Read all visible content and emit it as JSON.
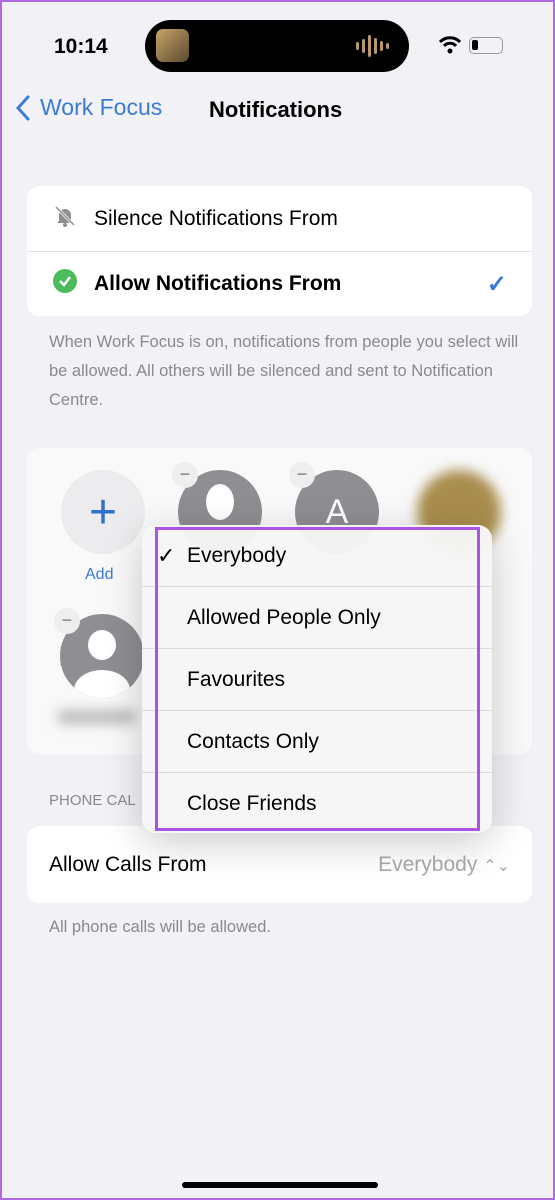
{
  "status": {
    "time": "10:14"
  },
  "nav": {
    "back_label": "Work Focus",
    "title": "Notifications"
  },
  "notifications": {
    "options": [
      {
        "label": "Silence Notifications From",
        "icon": "bell-slash-icon",
        "selected": false
      },
      {
        "label": "Allow Notifications From",
        "icon": "green-badge-check-icon",
        "selected": true
      }
    ],
    "description": "When Work Focus is on, notifications from people you select will be allowed. All others will be silenced and sent to Notification Centre."
  },
  "people": {
    "add_label": "Add",
    "contact_initial": "A"
  },
  "phone_calls": {
    "section_header": "PHONE CAL",
    "label": "Allow Calls From",
    "value": "Everybody",
    "note": "All phone calls will be allowed."
  },
  "menu": {
    "items": [
      {
        "label": "Everybody",
        "checked": true
      },
      {
        "label": "Allowed People Only"
      },
      {
        "label": "Favourites"
      },
      {
        "label": "Contacts Only"
      },
      {
        "label": "Close Friends"
      }
    ]
  },
  "colors": {
    "accent": "#3a7bd5",
    "highlight": "#a855e6",
    "green": "#4cbb5c"
  }
}
